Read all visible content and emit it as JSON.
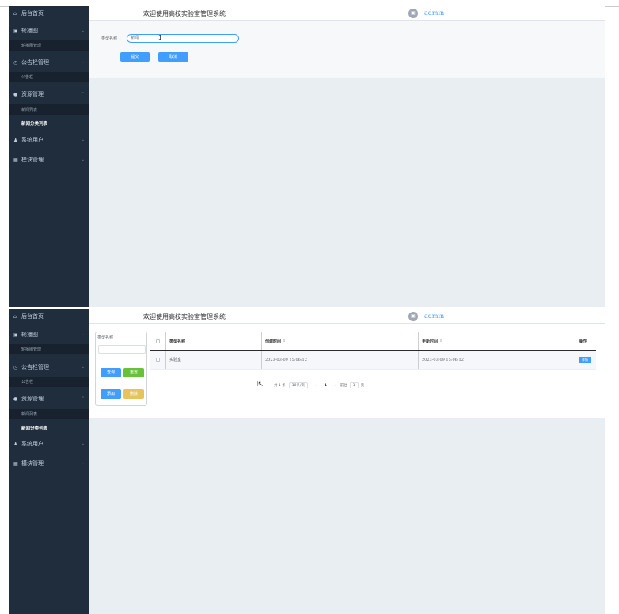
{
  "app": {
    "header_title": "欢迎使用高校实验室管理系统",
    "user_name": "admin"
  },
  "sidebar": {
    "home": "后台首页",
    "carousel": "轮播图",
    "carousel_manage": "轮播图管理",
    "notice": "公告栏管理",
    "notice_sub": "公告栏",
    "resource": "资源管理",
    "news_list": "新闻列表",
    "news_category": "新闻分类列表",
    "sys_user": "系统用户",
    "module": "模块管理"
  },
  "form": {
    "type_label": "类型名称",
    "type_value": "新闻",
    "submit": "提交",
    "cancel": "取消"
  },
  "list": {
    "search_label": "类型名称",
    "query_button": "查询",
    "reset_button": "重置",
    "add_button": "添加",
    "delete_button": "删除",
    "columns": [
      "类型名称",
      "创建时间",
      "更新时间",
      "操作"
    ],
    "rows": [
      {
        "type_name": "实验室",
        "created": "2023-03-09 15:06:12",
        "updated": "2023-03-09 15:06:12",
        "action": "详情"
      }
    ],
    "pagination": {
      "total": "共 1 条",
      "page_size": "10条/页",
      "current_page": "1",
      "goto_label": "前往",
      "goto_value": "1",
      "goto_suffix": "页"
    }
  }
}
